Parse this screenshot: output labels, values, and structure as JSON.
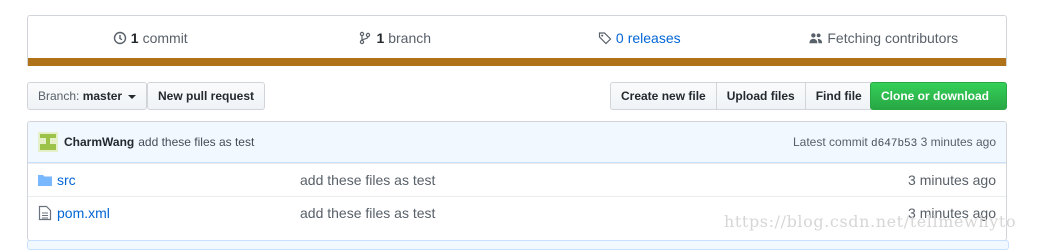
{
  "summary": {
    "commits_count": "1",
    "commits_label": "commit",
    "branches_count": "1",
    "branches_label": "branch",
    "releases_count": "0",
    "releases_label": "releases",
    "contributors_label": "Fetching contributors",
    "language_color": "#b07219"
  },
  "toolbar": {
    "branch_prefix": "Branch:",
    "branch_name": "master",
    "new_pull_request": "New pull request",
    "create_new_file": "Create new file",
    "upload_files": "Upload files",
    "find_file": "Find file",
    "clone_or_download": "Clone or download"
  },
  "latest_commit": {
    "author": "CharmWang",
    "message": "add these files as test",
    "prefix": "Latest commit",
    "sha": "d647b53",
    "age": "3 minutes ago"
  },
  "files": [
    {
      "type": "folder-icon",
      "name": "src",
      "message": "add these files as test",
      "age": "3 minutes ago"
    },
    {
      "type": "file-icon",
      "name": "pom.xml",
      "message": "add these files as test",
      "age": "3 minutes ago"
    }
  ],
  "watermark": "https://blog.csdn.net/tellmewhyto"
}
